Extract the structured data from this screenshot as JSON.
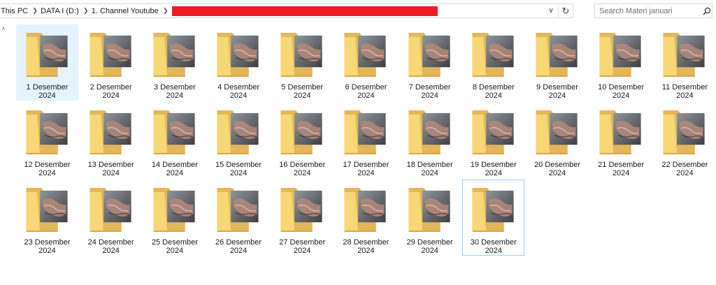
{
  "address_bar": {
    "crumbs": [
      "This PC",
      "DATA I (D:)",
      "1. Channel Youtube"
    ],
    "separator_icon": "chevron-right-icon"
  },
  "search": {
    "placeholder": "Search Materi januari"
  },
  "colors": {
    "redaction": "#ee1c25",
    "selection_fill": "#e5f3ff",
    "hover_border": "#99d1ff",
    "folder_back": "#e2b75a",
    "folder_front": "#f8d775"
  },
  "folders": [
    {
      "label": "1 Desember 2024",
      "state": "selected"
    },
    {
      "label": "2 Desember 2024"
    },
    {
      "label": "3 Desember 2024"
    },
    {
      "label": "4 Desember 2024"
    },
    {
      "label": "5 Desember 2024"
    },
    {
      "label": "6 Desember 2024"
    },
    {
      "label": "7 Desember 2024"
    },
    {
      "label": "8 Desember 2024"
    },
    {
      "label": "9 Desember 2024"
    },
    {
      "label": "10 Desember 2024"
    },
    {
      "label": "11 Desember 2024"
    },
    {
      "label": "12 Desember 2024"
    },
    {
      "label": "13 Desember 2024"
    },
    {
      "label": "14 Desember 2024"
    },
    {
      "label": "15 Desember 2024"
    },
    {
      "label": "16 Desember 2024"
    },
    {
      "label": "17 Desember 2024"
    },
    {
      "label": "18 Desember 2024"
    },
    {
      "label": "19 Desember 2024"
    },
    {
      "label": "20 Desember 2024"
    },
    {
      "label": "21 Desember 2024"
    },
    {
      "label": "22 Desember 2024"
    },
    {
      "label": "23 Desember 2024"
    },
    {
      "label": "24 Desember 2024"
    },
    {
      "label": "25 Desember 2024"
    },
    {
      "label": "26 Desember 2024"
    },
    {
      "label": "27 Desember 2024"
    },
    {
      "label": "28 Desember 2024"
    },
    {
      "label": "29 Desember 2024"
    },
    {
      "label": "30 Desember 2024",
      "state": "hover"
    }
  ]
}
